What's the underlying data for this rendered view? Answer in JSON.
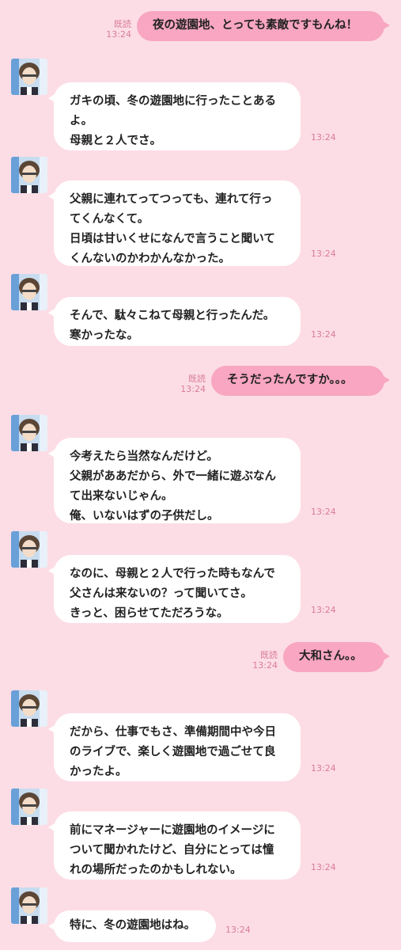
{
  "read_label": "既読",
  "messages": [
    {
      "side": "out",
      "text": "夜の遊園地、とっても素敵ですもんね！",
      "time": "13:24",
      "read": "既読"
    },
    {
      "side": "in",
      "text": "ガキの頃、冬の遊園地に行ったことある\nよ。\n母親と２人でさ。",
      "time": "13:24"
    },
    {
      "side": "in",
      "text": "父親に連れてってつっても、連れて行っ\nてくんなくて。\n日頃は甘いくせになんで言うこと聞いて\nくんないのかわかんなかった。",
      "time": "13:24"
    },
    {
      "side": "in",
      "text": "そんで、駄々こねて母親と行ったんだ。\n寒かったな。",
      "time": "13:24"
    },
    {
      "side": "out",
      "text": "そうだったんですか。。。",
      "time": "13:24",
      "read": "既読"
    },
    {
      "side": "in",
      "text": "今考えたら当然なんだけど。\n父親がああだから、外で一緒に遊ぶなん\nて出来ないじゃん。\n俺、いないはずの子供だし。",
      "time": "13:24"
    },
    {
      "side": "in",
      "text": "なのに、母親と２人で行った時もなんで\n父さんは来ないの？って聞いてさ。\nきっと、困らせてただろうな。",
      "time": "13:24"
    },
    {
      "side": "out",
      "text": "大和さん。。",
      "time": "13:24",
      "read": "既読"
    },
    {
      "side": "in",
      "text": "だから、仕事でもさ、準備期間中や今日\nのライブで、楽しく遊園地で過ごせて良\nかったよ。",
      "time": "13:24"
    },
    {
      "side": "in",
      "text": "前にマネージャーに遊園地のイメージに\nついて聞かれたけど、自分にとっては憧\nれの場所だったのかもしれない。",
      "time": "13:24"
    },
    {
      "side": "in",
      "text": "特に、冬の遊園地はね。",
      "time": "13:24"
    }
  ],
  "colors": {
    "background": "#fcdde5",
    "outgoing_bubble": "#f8a6c2",
    "incoming_bubble": "#ffffff",
    "meta_text": "#d97c9d"
  },
  "avatar_icon": "character-avatar-icon"
}
